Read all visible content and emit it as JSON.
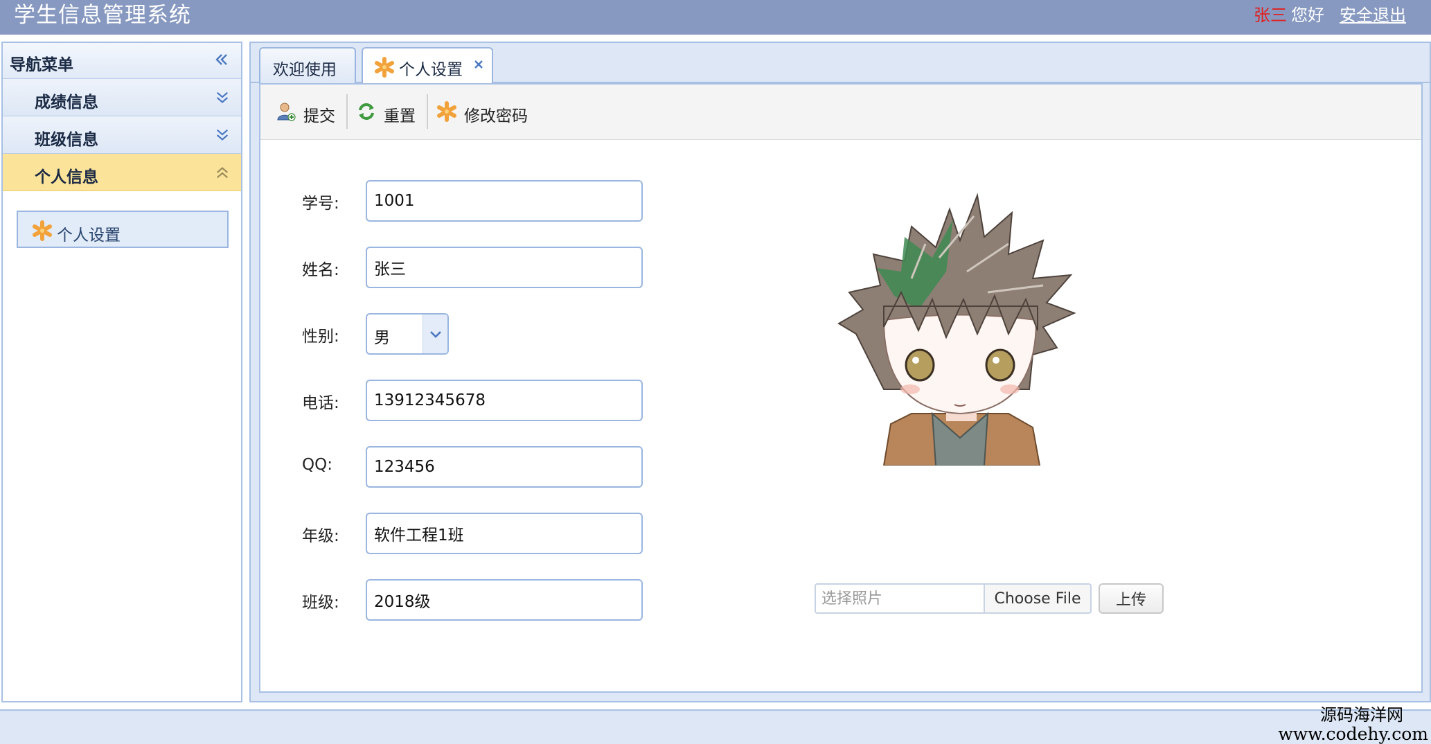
{
  "app": {
    "title": "学生信息管理系统",
    "user_name": "张三",
    "greeting": "您好",
    "logout_label": "安全退出"
  },
  "sidebar": {
    "title": "导航菜单",
    "collapse_icon": "double-chevron-left-icon",
    "sections": [
      {
        "label": "成绩信息",
        "expanded": false
      },
      {
        "label": "班级信息",
        "expanded": false
      },
      {
        "label": "个人信息",
        "expanded": true
      }
    ],
    "sub_item": {
      "label": "个人设置",
      "icon": "asterisk-icon"
    }
  },
  "tabs": [
    {
      "label": "欢迎使用",
      "active": false
    },
    {
      "label": "个人设置",
      "active": true,
      "icon": "asterisk-icon",
      "closable": true
    }
  ],
  "toolbar": {
    "submit_label": "提交",
    "reset_label": "重置",
    "change_password_label": "修改密码"
  },
  "form": {
    "student_id": {
      "label": "学号:",
      "value": "1001"
    },
    "name": {
      "label": "姓名:",
      "value": "张三"
    },
    "gender": {
      "label": "性别:",
      "value": "男"
    },
    "phone": {
      "label": "电话:",
      "value": "13912345678"
    },
    "qq": {
      "label": "QQ:",
      "value": "123456"
    },
    "grade": {
      "label": "年级:",
      "value": "软件工程1班"
    },
    "class": {
      "label": "班级:",
      "value": "2018级"
    }
  },
  "photo": {
    "placeholder": "选择照片",
    "choose_file_label": "Choose File",
    "upload_label": "上传"
  },
  "watermark": {
    "name": "源码海洋网",
    "url": "www.codehy.com"
  },
  "colors": {
    "header_bg": "#8799c0",
    "panel_border": "#a8c0e4",
    "active_section": "#fbe49a",
    "user_name": "#e02020"
  }
}
